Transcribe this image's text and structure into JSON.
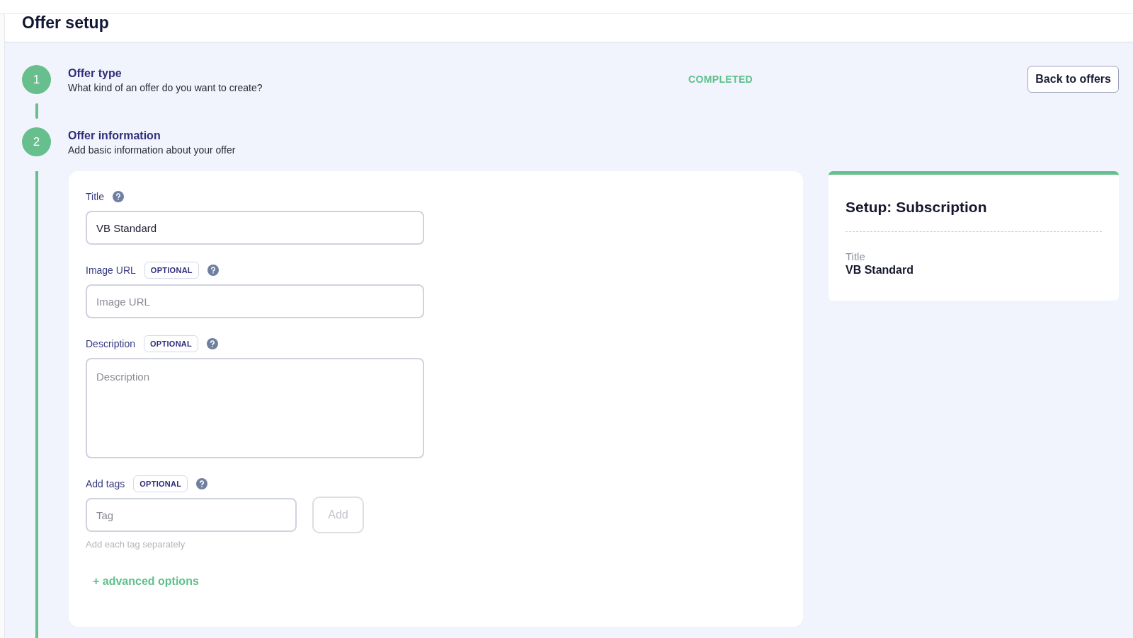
{
  "page_title": "Offer setup",
  "steps": [
    {
      "number": "1",
      "title": "Offer type",
      "subtitle": "What kind of an offer do you want to create?",
      "status": "COMPLETED"
    },
    {
      "number": "2",
      "title": "Offer information",
      "subtitle": "Add basic information about your offer"
    }
  ],
  "back_button": "Back to offers",
  "form": {
    "fields": [
      {
        "kind": "input",
        "label": "Title",
        "value": "VB Standard"
      },
      {
        "kind": "input",
        "label": "Image URL",
        "badge": "OPTIONAL",
        "placeholder": "Image URL"
      },
      {
        "kind": "textarea",
        "label": "Description",
        "badge": "OPTIONAL",
        "placeholder": "Description"
      },
      {
        "kind": "tags",
        "label": "Add tags",
        "badge": "OPTIONAL",
        "placeholder": "Tag",
        "button": "Add",
        "hint": "Add each tag separately"
      }
    ],
    "advanced_link": "+ advanced options"
  },
  "summary": {
    "heading": "Setup: Subscription",
    "items": [
      {
        "label": "Title",
        "value": "VB Standard"
      }
    ]
  }
}
